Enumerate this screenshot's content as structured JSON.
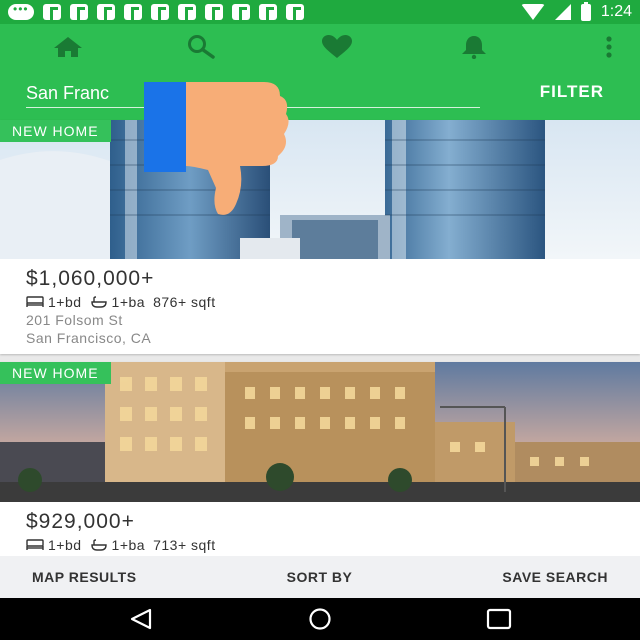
{
  "status_bar": {
    "time": "1:24",
    "icons": [
      "message-icon",
      "notification-icon",
      "wifi-icon",
      "signal-icon",
      "battery-icon"
    ]
  },
  "app_bar": {
    "icons": [
      "home-icon",
      "search-icon",
      "heart-icon",
      "bell-icon",
      "more-vert-icon"
    ],
    "search": {
      "value": "San Franc",
      "placeholder": ""
    },
    "filter_label": "FILTER"
  },
  "listings": [
    {
      "badge": "NEW HOME",
      "price": "$1,060,000+",
      "beds": "1+bd",
      "baths": "1+ba",
      "sqft": "876+ sqft",
      "street": "201 Folsom St",
      "city": "San Francisco, CA"
    },
    {
      "badge": "NEW HOME",
      "price": "$929,000+",
      "beds": "1+bd",
      "baths": "1+ba",
      "sqft": "713+ sqft"
    }
  ],
  "bottom_bar": {
    "map_results": "MAP RESULTS",
    "sort_by": "SORT BY",
    "save_search": "SAVE SEARCH"
  },
  "colors": {
    "brand_green": "#2dbe52",
    "status_green": "#1faa3f",
    "badge_green": "#35c15b"
  }
}
